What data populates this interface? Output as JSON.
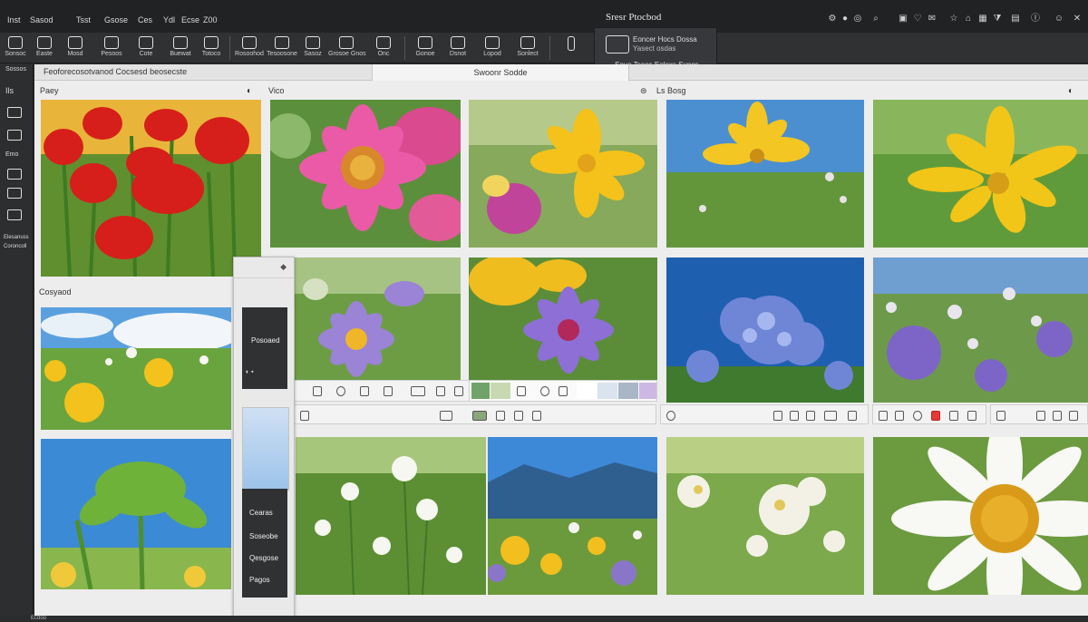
{
  "menubar": {
    "menus": [
      "Inst",
      "Sasod",
      "Tsst",
      "Gsose",
      "Ces",
      "Ydl",
      "Ecse",
      "Z00"
    ],
    "title": "Sresr Ptocbod",
    "right_icons": [
      "gear-icon",
      "user-icon",
      "settings-icon",
      "search-icon",
      "bookmark-icon",
      "heart-icon",
      "mail-icon",
      "star-icon",
      "home-icon",
      "grid-icon",
      "filter-icon",
      "lock-icon",
      "info-icon",
      "user-icon",
      "close-icon"
    ]
  },
  "toolbar": {
    "tools": [
      {
        "icon": "select-icon",
        "label": "Sonsoc"
      },
      {
        "icon": "settings-icon",
        "label": "Easte"
      },
      {
        "icon": "hand-icon",
        "label": "Mosd"
      },
      {
        "icon": "brush-icon",
        "label": "Pesoos"
      },
      {
        "icon": "pen-icon",
        "label": "Cote"
      },
      {
        "icon": "crop-icon",
        "label": "Buewat"
      },
      {
        "icon": "gear-icon",
        "label": "Totoco"
      },
      {
        "icon": "image-icon",
        "label": "Rosoohod"
      },
      {
        "icon": "triangle-icon",
        "label": "Tesoosone"
      },
      {
        "icon": "layers-icon",
        "label": "Sasoz"
      },
      {
        "icon": "bottle-icon",
        "label": "Grosoe Gnos"
      },
      {
        "icon": "document-icon",
        "label": "Onc"
      },
      {
        "icon": "frame-icon",
        "label": "Gonoe"
      },
      {
        "icon": "stamp-icon",
        "label": "Dsnot"
      },
      {
        "icon": "adjust-icon",
        "label": "Lopod"
      },
      {
        "icon": "export-icon",
        "label": "Sonlect"
      }
    ]
  },
  "dropdown": {
    "line1": "Eoncer Hocs Dossa",
    "line2": "Yasect osdas",
    "line3": "Soue Tsees Eolexs Sunos"
  },
  "sidebar": {
    "labels": [
      "Sossos",
      "Ils",
      "Emo",
      "Elesanuss",
      "Coroncoll"
    ]
  },
  "tabs": {
    "left": "Feoforecosotvanod Cocsesd beosecste",
    "center": "Swoonr Sodde"
  },
  "panels": {
    "left_head": "Paey",
    "center_head": "Vico",
    "right_head": "Ls Bosg",
    "second_head": "Cosyaod"
  },
  "floatpanel": {
    "dark_label": "Posoaed",
    "menu": [
      "Cearas",
      "Soseobe",
      "Qesgose",
      "Pagos"
    ]
  },
  "status": {
    "left": "Ecdoo"
  },
  "colors": {
    "swatches": [
      "#6fa36a",
      "#c8d9b2",
      "#ffffff",
      "#d9e4ef",
      "#a8b6c6",
      "#cdb7e3",
      "#e53935"
    ]
  }
}
